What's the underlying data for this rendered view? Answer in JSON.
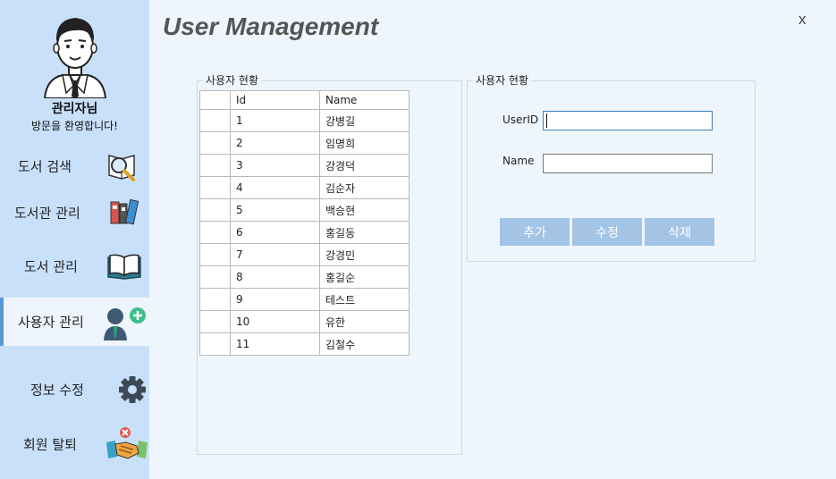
{
  "sidebar": {
    "admin_name": "관리자님",
    "welcome": "방문을 환영합니다!",
    "items": [
      {
        "label": "도서 검색",
        "icon": "magnifier-book-icon"
      },
      {
        "label": "도서관 관리",
        "icon": "binders-icon"
      },
      {
        "label": "도서 관리",
        "icon": "open-book-icon"
      },
      {
        "label": "사용자 관리",
        "icon": "add-user-icon",
        "active": true
      },
      {
        "label": "정보 수정",
        "icon": "gear-icon"
      },
      {
        "label": "회원 탈퇴",
        "icon": "handshake-remove-icon"
      }
    ]
  },
  "header": {
    "title": "User Management",
    "close_label": "x"
  },
  "user_list": {
    "group_title": "사용자 현황",
    "columns": [
      "Id",
      "Name"
    ],
    "rows": [
      {
        "id": "1",
        "name": "강병길"
      },
      {
        "id": "2",
        "name": "임명희"
      },
      {
        "id": "3",
        "name": "강경덕"
      },
      {
        "id": "4",
        "name": "김순자"
      },
      {
        "id": "5",
        "name": "백승현"
      },
      {
        "id": "6",
        "name": "홍길동"
      },
      {
        "id": "7",
        "name": "강경민"
      },
      {
        "id": "8",
        "name": "홍길순"
      },
      {
        "id": "9",
        "name": "테스트"
      },
      {
        "id": "10",
        "name": "유한"
      },
      {
        "id": "11",
        "name": "김철수"
      }
    ]
  },
  "user_form": {
    "group_title": "사용자 현황",
    "userid_label": "UserID",
    "userid_value": "",
    "name_label": "Name",
    "name_value": "",
    "add_label": "추가",
    "edit_label": "수정",
    "delete_label": "삭제"
  },
  "colors": {
    "sidebar_bg": "#c9e0fb",
    "content_bg": "#eef5fd",
    "button_bg": "#a4c4e6",
    "active_indicator": "#5b96d8"
  }
}
